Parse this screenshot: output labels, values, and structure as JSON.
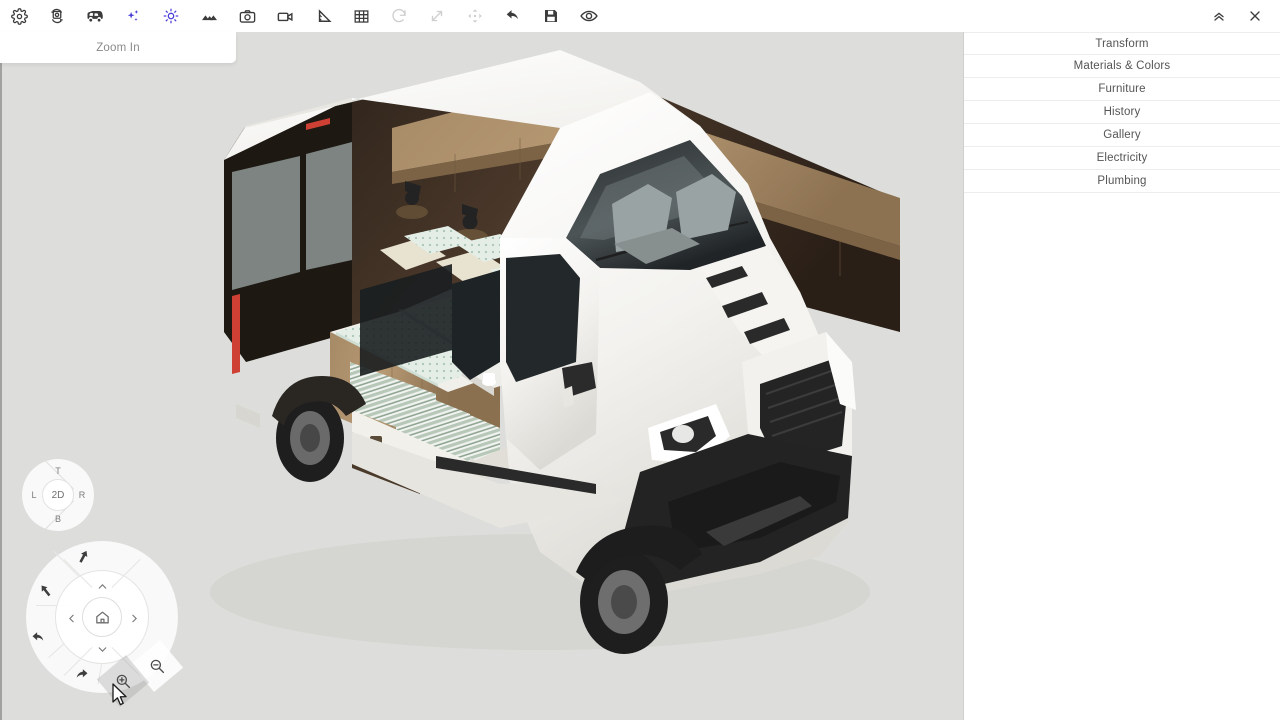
{
  "app": {
    "title": "Van Interior 3D Designer",
    "viewport_background": "#dddedb",
    "accent_color": "#4a3fd6"
  },
  "toolbar": {
    "items": [
      {
        "name": "settings-icon",
        "icon": "gear",
        "label": "Settings",
        "state": "normal"
      },
      {
        "name": "render-icon",
        "icon": "camera-360",
        "label": "Render",
        "state": "normal"
      },
      {
        "name": "vehicle-icon",
        "icon": "van",
        "label": "Vehicle",
        "state": "normal"
      },
      {
        "name": "ai-magic-icon",
        "icon": "sparkles",
        "label": "AI Magic",
        "state": "accent"
      },
      {
        "name": "lighting-icon",
        "icon": "sun",
        "label": "Lighting",
        "state": "accent"
      },
      {
        "name": "environment-icon",
        "icon": "mountains",
        "label": "Environment",
        "state": "normal"
      },
      {
        "name": "screenshot-icon",
        "icon": "camera",
        "label": "Screenshot",
        "state": "normal"
      },
      {
        "name": "video-icon",
        "icon": "video",
        "label": "Video",
        "state": "normal"
      },
      {
        "name": "measure-icon",
        "icon": "ruler",
        "label": "Measure",
        "state": "normal"
      },
      {
        "name": "grid-icon",
        "icon": "grid",
        "label": "Grid",
        "state": "normal"
      },
      {
        "name": "rotate-icon",
        "icon": "refresh",
        "label": "Rotate",
        "state": "disabled"
      },
      {
        "name": "scale-icon",
        "icon": "diagonal-arrows",
        "label": "Scale",
        "state": "disabled"
      },
      {
        "name": "move-icon",
        "icon": "move",
        "label": "Move",
        "state": "disabled"
      },
      {
        "name": "undo-icon",
        "icon": "undo",
        "label": "Undo",
        "state": "normal"
      },
      {
        "name": "save-icon",
        "icon": "floppy",
        "label": "Save",
        "state": "normal"
      },
      {
        "name": "visibility-icon",
        "icon": "eye",
        "label": "Visibility",
        "state": "normal"
      }
    ],
    "window_controls": [
      {
        "name": "collapse-button",
        "icon": "chevrons-up",
        "label": "Collapse"
      },
      {
        "name": "close-button",
        "icon": "close",
        "label": "Close"
      }
    ]
  },
  "tooltip": {
    "text": "Zoom In"
  },
  "side_panel": {
    "items": [
      {
        "label": "Transform"
      },
      {
        "label": "Materials & Colors"
      },
      {
        "label": "Furniture"
      },
      {
        "label": "History"
      },
      {
        "label": "Gallery"
      },
      {
        "label": "Electricity"
      },
      {
        "label": "Plumbing"
      }
    ]
  },
  "view_cube": {
    "top": "T",
    "bottom": "B",
    "left": "L",
    "right": "R",
    "center": "2D"
  },
  "nav_wheel": {
    "home_label": "Home",
    "pan_up": "Pan Up",
    "pan_down": "Pan Down",
    "pan_left": "Pan Left",
    "pan_right": "Pan Right",
    "orbit_up_left": "Orbit Up Left",
    "orbit_left": "Orbit Left",
    "orbit_back": "Orbit Back",
    "orbit_bottom_left": "Orbit Bottom Left",
    "zoom_in": "Zoom In",
    "zoom_out": "Zoom Out",
    "zoom_in_state": "hovered"
  },
  "scene": {
    "model": "camper van interior",
    "vehicle_color": "#f4f3f0",
    "wood_color": "#9e8160",
    "dark_panel_color": "#3b2d22",
    "bedding_color": "#dfe9e2",
    "cushion_color": "#e6dcc8"
  }
}
